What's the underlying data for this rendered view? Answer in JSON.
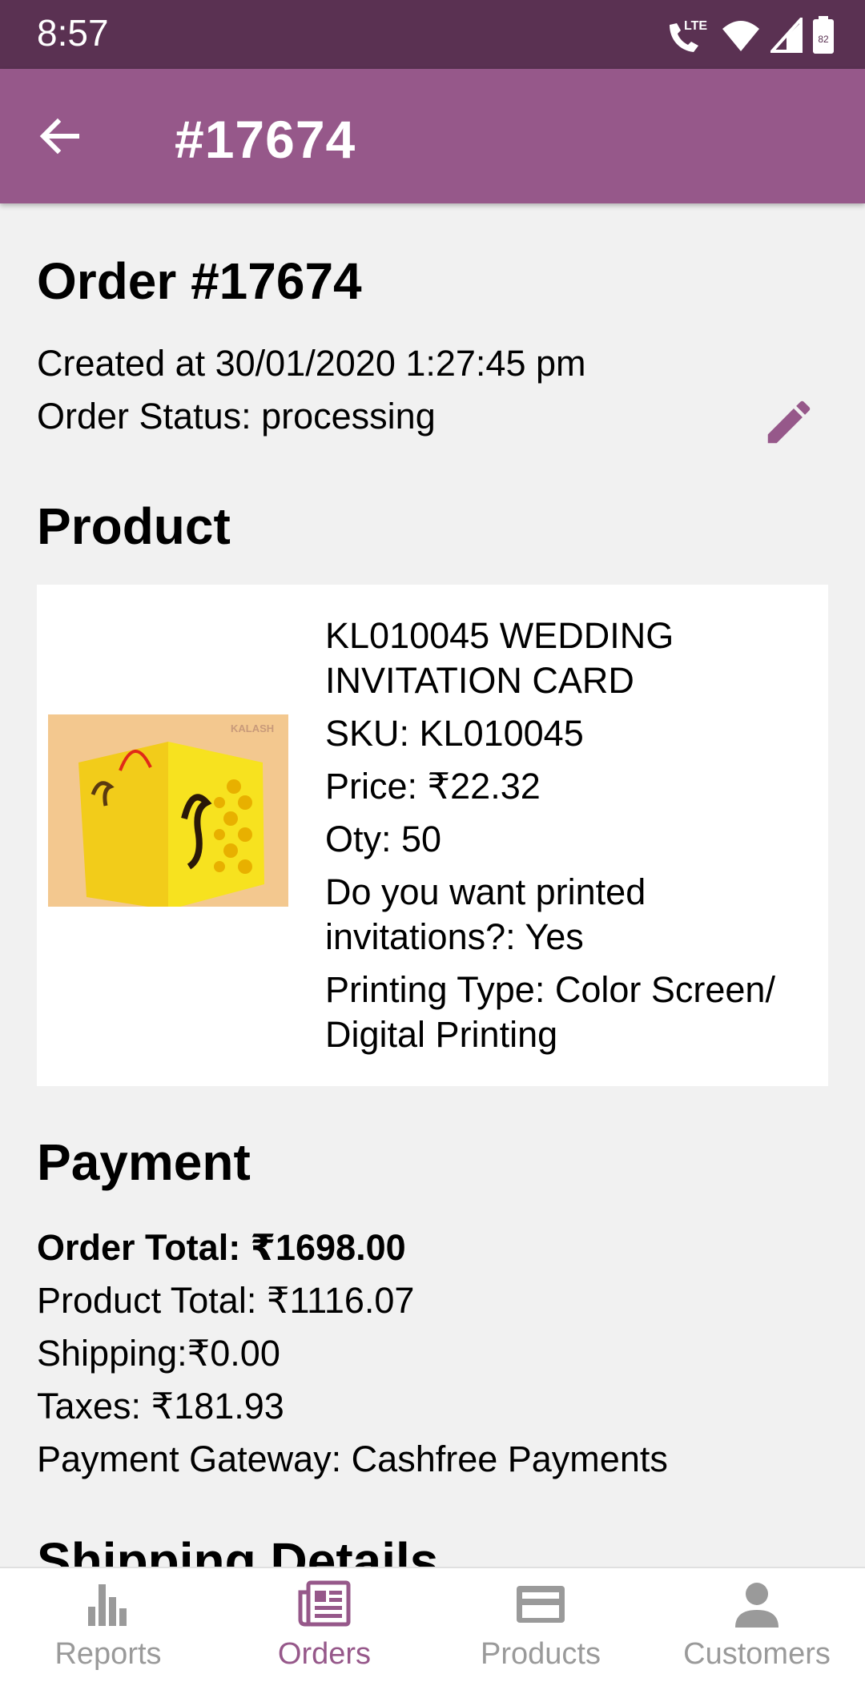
{
  "status_bar": {
    "time": "8:57",
    "network": "LTE",
    "battery": "82"
  },
  "app_bar": {
    "title": "#17674"
  },
  "order": {
    "heading": "Order #17674",
    "created": "Created at 30/01/2020 1:27:45 pm",
    "status": "Order Status: processing"
  },
  "product": {
    "heading": "Product",
    "name": "KL010045 WEDDING INVITATION CARD",
    "sku": "SKU: KL010045",
    "price": "Price: ₹22.32",
    "qty": "Oty: 50",
    "printed": "Do you want printed invitations?: Yes",
    "printing_type": "Printing Type: Color Screen/ Digital Printing",
    "image_brand": "KALASH"
  },
  "payment": {
    "heading": "Payment",
    "order_total": "Order Total: ₹1698.00",
    "product_total": "Product Total: ₹1116.07",
    "shipping": "Shipping:₹0.00",
    "taxes": "Taxes: ₹181.93",
    "gateway": "Payment Gateway: Cashfree Payments"
  },
  "shipping": {
    "heading": "Shipping Details"
  },
  "bottom_nav": {
    "items": [
      {
        "label": "Reports",
        "icon": "bar-chart-icon"
      },
      {
        "label": "Orders",
        "icon": "orders-icon"
      },
      {
        "label": "Products",
        "icon": "card-icon"
      },
      {
        "label": "Customers",
        "icon": "person-icon"
      }
    ],
    "active": "Orders"
  },
  "colors": {
    "status_bar": "#5a3152",
    "app_bar": "#96588a",
    "accent": "#96588a",
    "inactive": "#9a9a9a"
  }
}
